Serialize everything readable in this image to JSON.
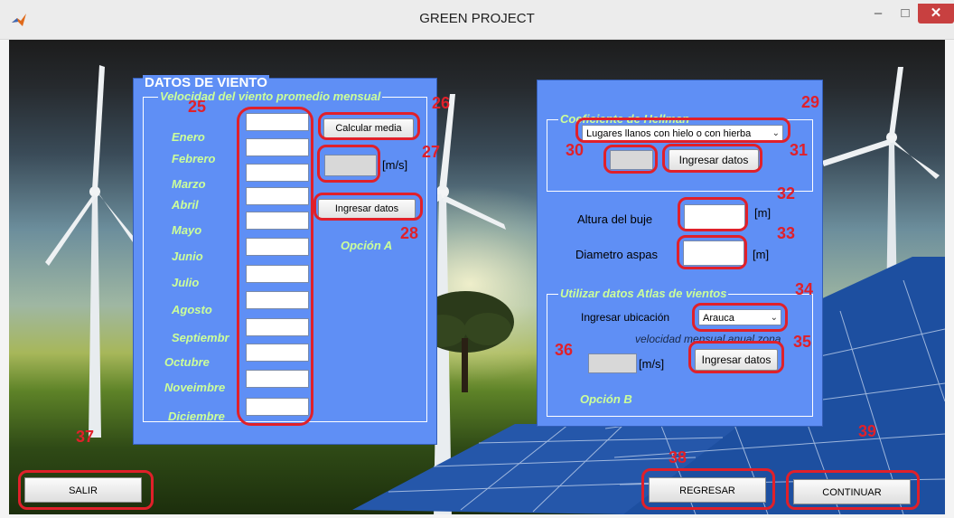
{
  "window": {
    "title": "GREEN PROJECT",
    "min": "–",
    "max": "□",
    "close": "✕"
  },
  "wind_panel": {
    "title": "DATOS DE VIENTO",
    "group_title": "Velocidad del viento promedio mensual",
    "months": [
      "Enero",
      "Febrero",
      "Marzo",
      "Abril",
      "Mayo",
      "Junio",
      "Julio",
      "Agosto",
      "Septiembr",
      "Octubre",
      "Noveimbre",
      "Diciembre"
    ],
    "month_values": [
      "",
      "",
      "",
      "",
      "",
      "",
      "",
      "",
      "",
      "",
      "",
      ""
    ],
    "calc_button": "Calcular media",
    "mean_value": "",
    "mean_unit": "[m/s]",
    "ingresar_button": "Ingresar datos",
    "option_label": "Opción A"
  },
  "right_panel": {
    "hellman_title": "Coeficiente de Hellman",
    "hellman_select": "Lugares llanos con hielo o con hierba",
    "hellman_value": "",
    "hellman_button": "Ingresar datos",
    "altura_label": "Altura del buje",
    "altura_value": "",
    "altura_unit": "[m]",
    "diametro_label": "Diametro aspas",
    "diametro_value": "",
    "diametro_unit": "[m]",
    "atlas_title": "Utilizar datos Atlas de vientos",
    "ubicacion_label": "Ingresar ubicación",
    "ubicacion_select": "Arauca",
    "velocidad_label": "velocidad mensual anual zona",
    "atlas_value": "",
    "atlas_unit": "[m/s]",
    "atlas_button": "Ingresar datos",
    "option_label": "Opción B"
  },
  "bottom": {
    "salir": "SALIR",
    "regresar": "REGRESAR",
    "continuar": "CONTINUAR"
  },
  "annotations": [
    "25",
    "26",
    "27",
    "28",
    "29",
    "30",
    "31",
    "32",
    "33",
    "34",
    "35",
    "36",
    "37",
    "38",
    "39"
  ],
  "colors": {
    "panel": "#5f8ff5",
    "label_green": "#ccff99",
    "annotation_red": "#e0202a"
  }
}
